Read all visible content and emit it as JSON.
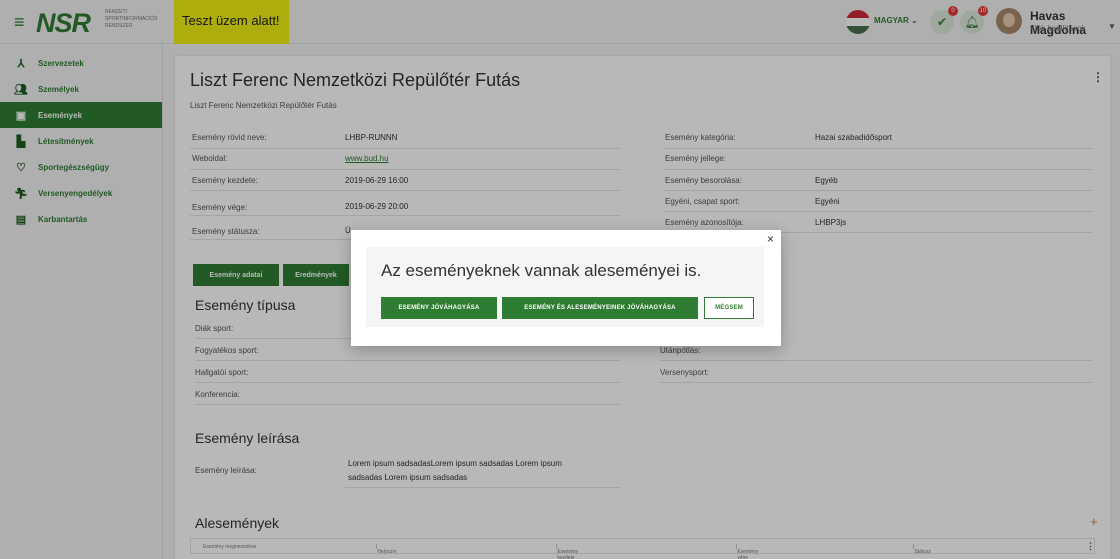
{
  "header": {
    "logo": "NSR",
    "logo_sub": "Nemzeti Sportinformációs Rendszer",
    "test_banner": "Teszt üzem alatt!",
    "language": "MAGYAR",
    "approvals_badge": "0",
    "notifications_badge": "10",
    "user_name": "Havas Magdolna",
    "user_sub": "Fiók beállítások"
  },
  "sidebar": {
    "items": [
      {
        "label": "Szervezetek",
        "icon": "organization-icon"
      },
      {
        "label": "Személyek",
        "icon": "people-icon"
      },
      {
        "label": "Események",
        "icon": "calendar-icon"
      },
      {
        "label": "Létesítmények",
        "icon": "building-icon"
      },
      {
        "label": "Sportegészségügy",
        "icon": "heart-icon"
      },
      {
        "label": "Versenyengedélyek",
        "icon": "runner-icon"
      },
      {
        "label": "Karbantartás",
        "icon": "clipboard-icon"
      }
    ],
    "active_index": 2
  },
  "main": {
    "title": "Liszt Ferenc Nemzetközi Repülőtér Futás",
    "subtitle": "Liszt Ferenc Nemzetközi Repülőtér Futás",
    "left_fields": [
      {
        "label": "Esemény rövid neve:",
        "value": "LHBP-RUNNN"
      },
      {
        "label": "Weboldal:",
        "value": "www.bud.hu"
      },
      {
        "label": "Esemény kezdete:",
        "value": "2019-06-29 16:00"
      },
      {
        "label": "Esemény vége:",
        "value": "2019-06-29 20:00"
      },
      {
        "label": "Esemény státusza:",
        "value": "Ú"
      }
    ],
    "right_fields": [
      {
        "label": "Esemény kategória:",
        "value": "Hazai szabadidősport"
      },
      {
        "label": "Esemény jellege:",
        "value": ""
      },
      {
        "label": "Esemény besorolása:",
        "value": "Egyéb"
      },
      {
        "label": "Egyéni, csapat sport:",
        "value": "Egyéni"
      },
      {
        "label": "Esemény azonosítója:",
        "value": "LHBP3js"
      }
    ],
    "tabs": [
      "Esemény adatai",
      "Eredmények"
    ],
    "type_section": {
      "title": "Esemény típusa",
      "left": [
        "Diák sport:",
        "Fogyatékos sport:",
        "Hallgatói sport:",
        "Konferencia:"
      ],
      "right": [
        "Utánpótlás:",
        "Versenysport:"
      ]
    },
    "desc_section": {
      "title": "Esemény leírása",
      "label": "Esemény leírása:",
      "line1": "Lorem ipsum sadsadasLorem ipsum sadsadas Lorem ipsum",
      "line2": "sadsadas Lorem ipsum sadsadas"
    },
    "sub_section": {
      "title": "Alesemények",
      "add": "+",
      "columns": [
        "Esemény megnevezése",
        "Helyszín",
        "Esemény kezdete",
        "Esemény vége",
        "Státusz"
      ]
    }
  },
  "modal": {
    "title": "Az eseményeknek vannak aleseményei is.",
    "close": "×",
    "btn_approve": "ESEMÉNY JÓVÁHAGYÁSA",
    "btn_approve_all": "ESEMÉNY ÉS ALESEMÉNYEINEK JÓVÁHAGYÁSA",
    "btn_cancel": "MÉGSEM"
  },
  "colors": {
    "brand_green": "#2e7d32",
    "test_banner": "#f0f013",
    "accent_orange": "#e67e22"
  }
}
